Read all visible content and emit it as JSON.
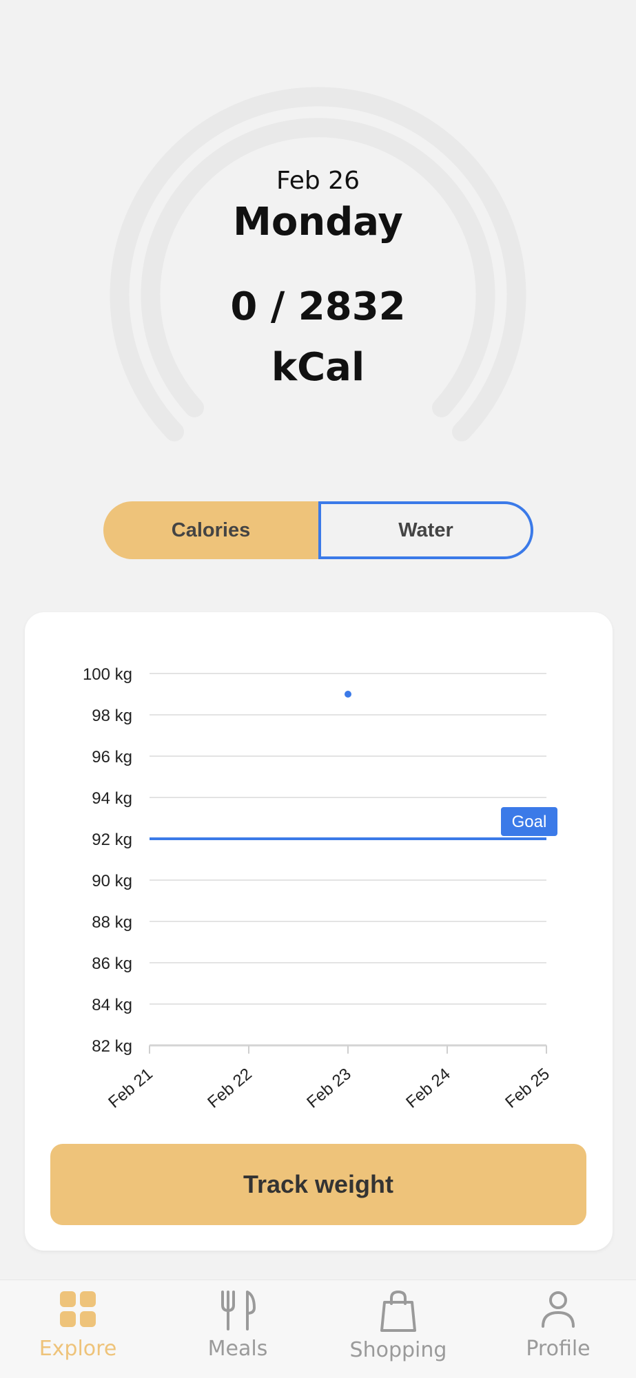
{
  "summary": {
    "date": "Feb 26",
    "weekday": "Monday",
    "calories": "0 / 2832",
    "unit": "kCal"
  },
  "toggle": {
    "left_label": "Calories",
    "right_label": "Water",
    "selected": "Water"
  },
  "chart_data": {
    "type": "scatter",
    "x": [
      "Feb 21",
      "Feb 22",
      "Feb 23",
      "Feb 24",
      "Feb 25"
    ],
    "y_ticks": [
      "100 kg",
      "98 kg",
      "96 kg",
      "94 kg",
      "92 kg",
      "90 kg",
      "88 kg",
      "86 kg",
      "84 kg",
      "82 kg"
    ],
    "ylim": [
      82,
      100
    ],
    "points": [
      {
        "x": "Feb 23",
        "y": 99
      }
    ],
    "goal": {
      "label": "Goal",
      "value": 92
    },
    "grid": true,
    "colors": {
      "point": "#3b7ae8",
      "goal": "#3b7ae8",
      "grid": "#e3e3e3"
    }
  },
  "actions": {
    "track_weight": "Track weight"
  },
  "tabbar": {
    "items": [
      {
        "label": "Explore",
        "icon": "grid-icon",
        "active": true
      },
      {
        "label": "Meals",
        "icon": "fork-knife-icon",
        "active": false
      },
      {
        "label": "Shopping",
        "icon": "shopping-bag-icon",
        "active": false
      },
      {
        "label": "Profile",
        "icon": "person-icon",
        "active": false
      }
    ]
  },
  "colors": {
    "accent": "#eec37a",
    "blue": "#3b7ae8",
    "background": "#f2f2f2"
  }
}
